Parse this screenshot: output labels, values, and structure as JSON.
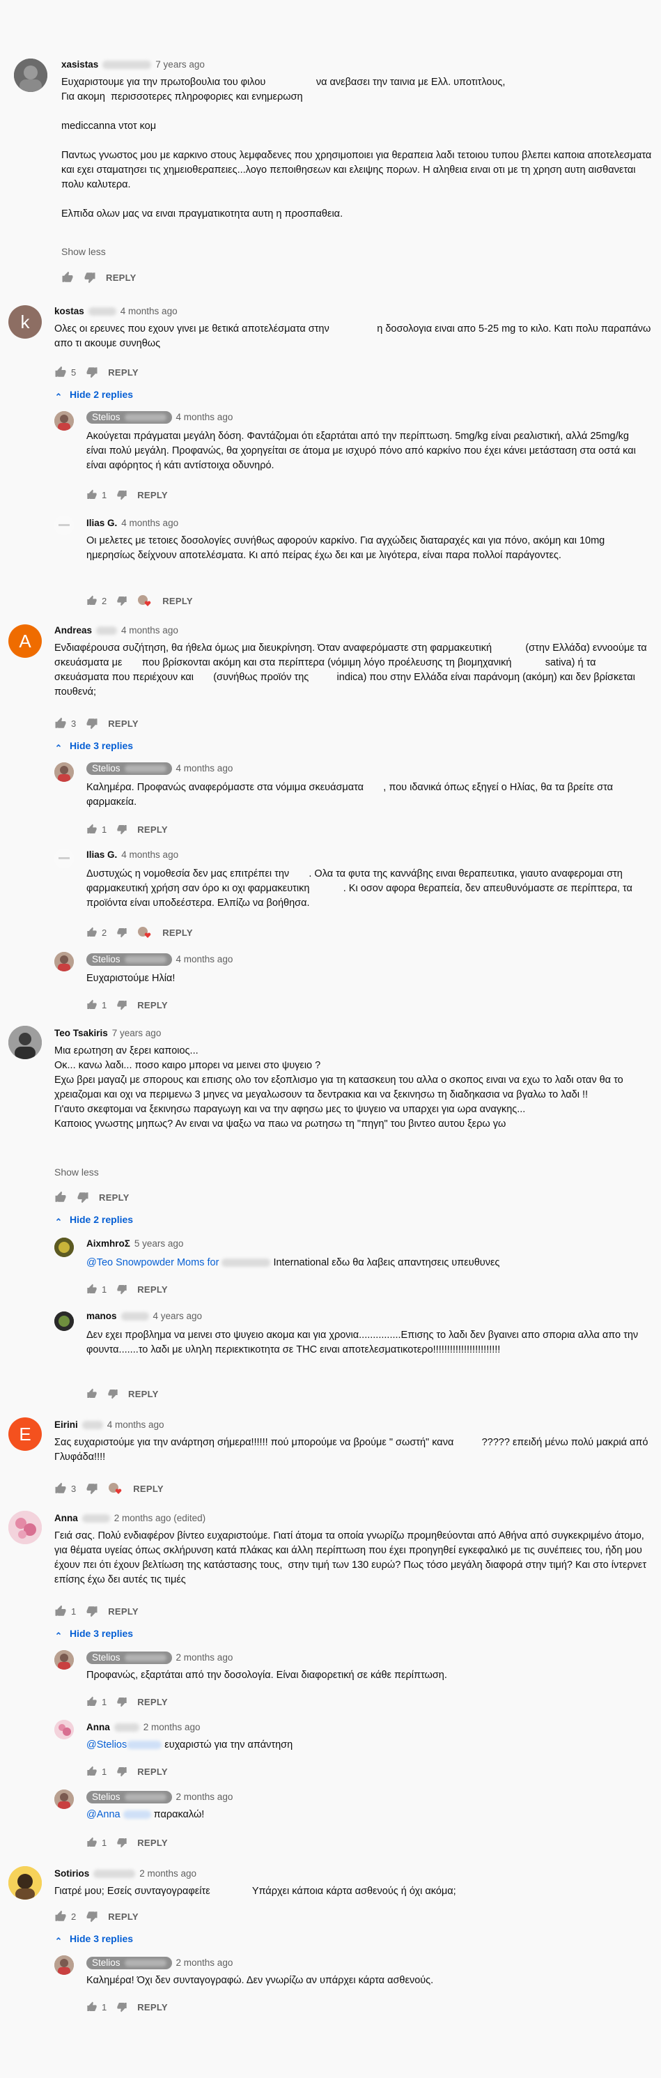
{
  "labels": {
    "reply": "REPLY",
    "show_less": "Show less"
  },
  "c1": {
    "author": "xasistas",
    "time": "7 years ago",
    "body": "Ευχαριστουμε για την πρωτοβουλια του φιλου                  να ανεβασει την ταινια με Ελλ. υποτιτλους,\nΓια ακομη  περισσοτερες πληροφοριες και ενημερωση\n\nmediccanna ντοτ κομ\n\nΠαντως γνωστος μου με καρκινο στους λεμφαδενες που χρησιμοποιει για θεραπεια λαδι τετοιου τυπου βλεπει καποια αποτελεσματα και εχει σταματησει τις χημειοθεραπειες...λογο πεποιθησεων και ελειψης πορων. Η αληθεια ειναι οτι με τη χρηση αυτη αισθανεται πολυ καλυτερα.\n\nΕλπιδα ολων μας να ειναι πραγματικοτητα αυτη η προσπαθεια."
  },
  "c2": {
    "author": "kostas",
    "time": "4 months ago",
    "likes": "5",
    "toggle": "Hide 2 replies",
    "body": "Ολες οι ερευνες που εχουν γινει με θετικά αποτελέσματα στην                 η δοσολογια ειναι απο 5-25 mg το κιλο. Κατι πολυ παραπάνω απο τι ακουμε συνηθως"
  },
  "r2a": {
    "author": "Stelios",
    "time": "4 months ago",
    "likes": "1",
    "body": "Ακούγεται πράγμαται μεγάλη δόση. Φαντάζομαι ότι εξαρτάται από την περίπτωση. 5mg/kg είναι ρεαλιστική, αλλά 25mg/kg είναι πολύ μεγάλη. Προφανώς, θα χορηγείται σε άτομα με ισχυρό πόνο από καρκίνο που έχει κάνει μετάσταση στα οστά και είναι αφόρητος ή κάτι αντίστοιχα οδυνηρό."
  },
  "r2b": {
    "author": "Ilias G.",
    "time": "4 months ago",
    "likes": "2",
    "body": "Οι μελετες με τετοιες δοσολογίες συνήθως αφορούν καρκίνο. Για αγχώδεις διαταραχές και για πόνο, ακόμη και 10mg ημερησίως δείχνουν αποτελέσματα. Κι από πείρας έχω δει και με λιγότερα, είναι παρα πολλοί παράγοντες."
  },
  "c3": {
    "author": "Andreas",
    "time": "4 months ago",
    "likes": "3",
    "toggle": "Hide 3 replies",
    "body": "Ενδιαφέρουσα συζήτηση, θα ήθελα όμως μια διευκρίνηση. Όταν αναφερόμαστε στη φαρμακευτική            (στην Ελλάδα) εννοούμε τα σκευάσματα με       που βρίσκονται ακόμη και στα περίπτερα (νόμιμη λόγο προέλευσης τη βιομηχανική            sativa) ή τα σκευάσματα που περιέχουν και       (συνήθως προϊόν της          indica) που στην Ελλάδα είναι παράνομη (ακόμη) και δεν βρίσκεται πουθενά;"
  },
  "r3a": {
    "author": "Stelios",
    "time": "4 months ago",
    "likes": "1",
    "body": "Καλημέρα. Προφανώς αναφερόμαστε στα νόμιμα σκευάσματα       , που ιδανικά όπως εξηγεί ο Ηλίας, θα τα βρείτε στα φαρμακεία."
  },
  "r3b": {
    "author": "Ilias G.",
    "time": "4 months ago",
    "likes": "2",
    "body": "Δυστυχώς η νομοθεσία δεν μας επιτρέπει την       . Ολα τα φυτα της καννάβης ειναι θεραπευτικα, γιαυτο αναφερομαι στη φαρμακευτική χρήση σαν όρο κι οχι φαρμακευτικη            . Κι οσον αφορα θεραπεία, δεν απευθυνόμαστε σε περίπτερα, τα προϊόντα είναι υποδεέστερα. Ελπίζω να βοήθησα."
  },
  "r3c": {
    "author": "Stelios",
    "time": "4 months ago",
    "likes": "1",
    "body": "Ευχαριστούμε Ηλία!"
  },
  "c4": {
    "author": "Teo Tsakiris",
    "time": "7 years ago",
    "toggle": "Hide 2 replies",
    "body": "Μια ερωτηση αν ξερει καποιος...\nΟκ... κανω λαδι... ποσο καιρο μπορει να μεινει στο ψυγειο ?\nΕχω βρει μαγαζι με σπορους και επισης ολο τον εξοπλισμο για τη κατασκευη του αλλα ο σκοπος ειναι να εχω το λαδι οταν θα το χρειαζομαι και οχι να περιμενω 3 μηνες να μεγαλωσουν τα δεντρακια και να ξεκινησω τη διαδηκασια να βγαλω το λαδι !!\nΓι'αυτο σκεφτομαι να ξεκινησω παραγωγη και να την αφησω μες το ψυγειο να υπαρχει για ωρα αναγκης...\nΚαποιος γνωστης μηπως? Αν ειναι να ψαξω να πaω να ρωτησω τη \"πηγη\" του βιντεο αυτου ξερω γω"
  },
  "r4a": {
    "author": "AixmhroΣ",
    "time": "5 years ago",
    "likes": "1",
    "mention": "@Teo Snowpowder Moms for",
    "body": "International εδω θα λαβεις απαντησεις υπευθυνες"
  },
  "r4b": {
    "author": "manos",
    "time": "4 years ago",
    "body": "Δεν εχει προβλημα να μεινει στο ψυγειο ακομα και για χρονια...............Επισης το λαδι δεν βγαινει απο σπορια αλλα απο την φουντα.......το λαδι με υληλη περιεκτικοτητα σε THC ειναι αποτελεσματικοτερο!!!!!!!!!!!!!!!!!!!!!!!!"
  },
  "c5": {
    "author": "Eirini",
    "time": "4 months ago",
    "likes": "3",
    "body": "Σας ευχαριστούμε για την ανάρτηση σήμερα!!!!!! πού μπορούμε να βρούμε \" σωστή\" κανα          ????? επειδή μένω πολύ μακριά από Γλυφάδα!!!!"
  },
  "c6": {
    "author": "Anna",
    "time": "2 months ago (edited)",
    "likes": "1",
    "toggle": "Hide 3 replies",
    "body": "Γειά σας. Πολύ ενδιαφέρον βίντεο ευχαριστούμε. Γιατί άτομα τα οποία γνωρίζω προμηθεύονται από Αθήνα από συγκεκριμένο άτομο, για θέματα υγείας όπως σκλήρυνση κατά πλάκας και άλλη περίπτωση που έχει προηγηθεί εγκεφαλικό με τις συνέπειες του, ήδη μου έχουν πει ότι έχουν βελτίωση της κατάστασης τους,  στην τιμή των 130 ευρώ? Πως τόσο μεγάλη διαφορά στην τιμή? Και στο ίντερνετ επίσης έχω δει αυτές τις τιμές"
  },
  "r6a": {
    "author": "Stelios",
    "time": "2 months ago",
    "likes": "1",
    "body": "Προφανώς, εξαρτάται από την δοσολογία. Είναι διαφορετική σε κάθε περίπτωση."
  },
  "r6b": {
    "author": "Anna",
    "time": "2 months ago",
    "likes": "1",
    "mention": "@Stelios",
    "body": "ευχαριστώ για την απάντηση"
  },
  "r6c": {
    "author": "Stelios",
    "time": "2 months ago",
    "likes": "1",
    "mention": "@Anna",
    "body": "παρακαλώ!"
  },
  "c7": {
    "author": "Sotirios",
    "time": "2 months ago",
    "likes": "2",
    "toggle": "Hide 3 replies",
    "body": "Γιατρέ μου; Εσείς συνταγογραφείτε               Υπάρχει κάποια κάρτα ασθενούς ή όχι ακόμα;"
  },
  "r7a": {
    "author": "Stelios",
    "time": "2 months ago",
    "likes": "1",
    "body": "Καλημέρα! Όχι δεν συνταγογραφώ. Δεν γνωρίζω αν υπάρχει κάρτα ασθενούς."
  },
  "colors": {
    "link": "#065fd4",
    "meta": "#606060",
    "background": "#f9f9f9",
    "heart": "#e53935"
  }
}
